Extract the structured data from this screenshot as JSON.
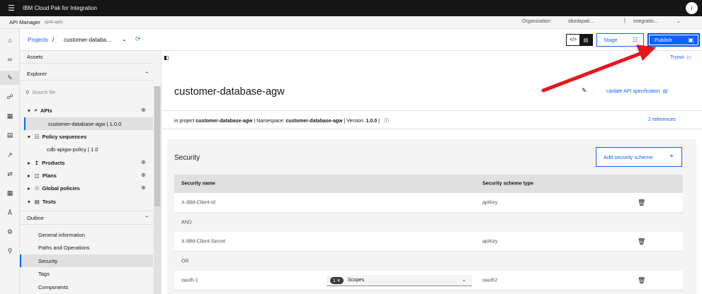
{
  "topbar": {
    "brand": "IBM Cloud Pak for Integration",
    "user_initial": "i"
  },
  "appbar": {
    "app_name": "API Manager",
    "instance": "cp4i-apic",
    "org_label": "Organization:",
    "org_value": "sbodapati...",
    "divider": "|",
    "catalog_value": "integratio..."
  },
  "rail_icons": [
    "home-icon",
    "api-icon",
    "develop-icon",
    "test-icon",
    "apps-icon",
    "catalog-icon",
    "analytics-icon",
    "gateway-icon",
    "admin-icon",
    "members-icon",
    "settings-icon",
    "search-icon"
  ],
  "breadcrumb": {
    "projects": "Projects",
    "sep": "/",
    "api": "customer-databa..."
  },
  "toolbar": {
    "stage_label": "Stage",
    "publish_label": "Publish",
    "tryout_label": "Tryout"
  },
  "explorer": {
    "assets_label": "Assets",
    "explorer_label": "Explorer",
    "search_placeholder": "Search file",
    "apis_label": "APIs",
    "api_item": "customer-database-agw | 1.0.0",
    "policy_sequences_label": "Policy sequences",
    "policy_item": "cdb-apigw-policy | 1.0",
    "products_label": "Products",
    "plans_label": "Plans",
    "global_policies_label": "Global policies",
    "tests_label": "Tests",
    "outline_label": "Outline",
    "outline_items": [
      "General information",
      "Paths and Operations",
      "Security",
      "Tags",
      "Components"
    ]
  },
  "main": {
    "title": "customer-database-agw",
    "update_spec": "Update API specification",
    "meta_prefix": "in project",
    "meta_project": "customer-database-agw",
    "meta_ns_label": "| Namespace:",
    "meta_ns": "customer-database-agw",
    "meta_version_label": "| Version:",
    "meta_version": "1.0.0",
    "meta_end": "|",
    "references": "2 references"
  },
  "security": {
    "title": "Security",
    "add_label": "Add security scheme",
    "col_name": "Security name",
    "col_type": "Security scheme type",
    "rows": [
      {
        "name": "X-IBM-Client-Id",
        "type": "apiKey"
      },
      {
        "join": "AND"
      },
      {
        "name": "X-IBM-Client-Secret",
        "type": "apiKey"
      },
      {
        "join": "OR"
      },
      {
        "name": "oauth-1",
        "type": "oauth2",
        "scope_count": "1",
        "scope_label": "Scopes"
      }
    ]
  },
  "colors": {
    "accent": "#0f62fe",
    "annotation": "#e8141c"
  }
}
